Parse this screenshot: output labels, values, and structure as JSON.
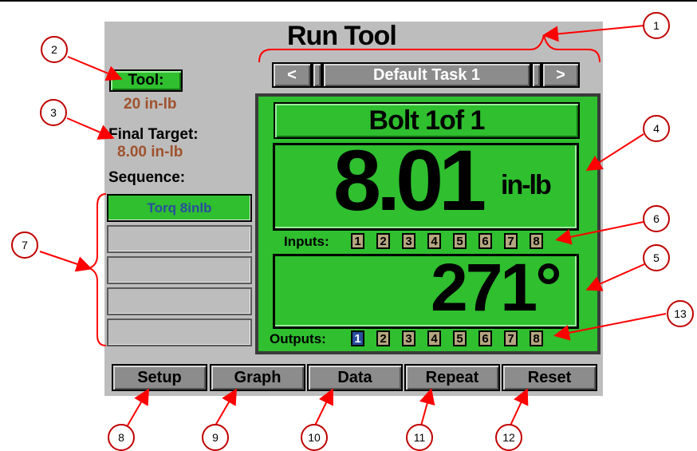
{
  "screen_title": "Run Tool",
  "task_nav": {
    "prev_label": "<",
    "task_name": "Default Task 1",
    "next_label": ">"
  },
  "tool": {
    "button_label": "Tool:",
    "value": "20 in-lb"
  },
  "final_target": {
    "label": "Final Target:",
    "value": "8.00 in-lb"
  },
  "sequence": {
    "label": "Sequence:",
    "items": [
      "Torq 8inlb",
      "",
      "",
      "",
      ""
    ]
  },
  "bolt_label": "Bolt 1of 1",
  "torque": {
    "value": "8.01",
    "unit": "in-lb"
  },
  "angle": {
    "value": "271°"
  },
  "inputs": {
    "label": "Inputs:",
    "channels": [
      "1",
      "2",
      "3",
      "4",
      "5",
      "6",
      "7",
      "8"
    ],
    "active": []
  },
  "outputs": {
    "label": "Outputs:",
    "channels": [
      "1",
      "2",
      "3",
      "4",
      "5",
      "6",
      "7",
      "8"
    ],
    "active": [
      "1"
    ]
  },
  "bottom_buttons": {
    "setup": "Setup",
    "graph": "Graph",
    "data": "Data",
    "repeat": "Repeat",
    "reset": "Reset"
  },
  "callouts": [
    "1",
    "2",
    "3",
    "4",
    "5",
    "6",
    "7",
    "8",
    "9",
    "10",
    "11",
    "12",
    "13"
  ],
  "colors": {
    "screen_bg": "#bdbdbd",
    "active_green": "#2fbf2f",
    "value_brown": "#a0522d",
    "output_on": "#2a4e9e",
    "callout_red": "#c00000"
  }
}
